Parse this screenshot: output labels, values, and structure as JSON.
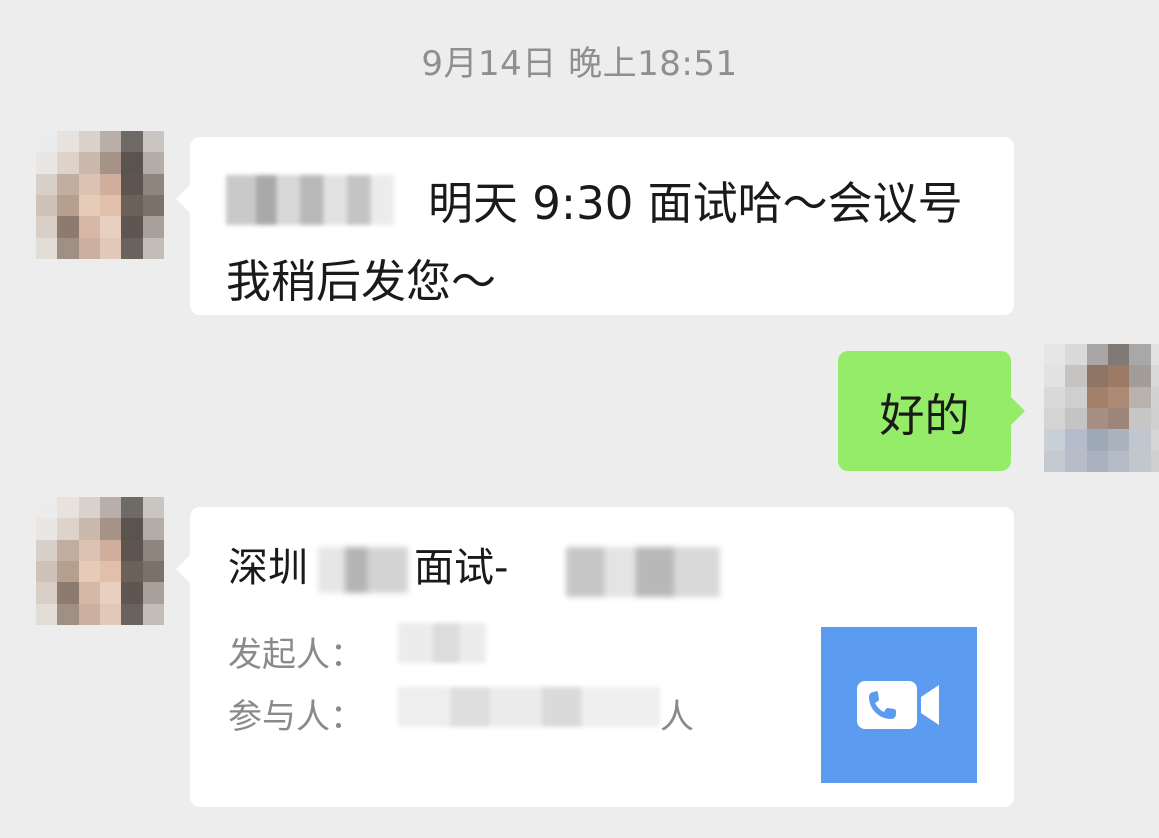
{
  "chat": {
    "timestamp": "9月14日 晚上18:51",
    "messages": [
      {
        "from": "contact",
        "text": "明天 9:30 面试哈～会议号我稍后发您～"
      },
      {
        "from": "me",
        "text": "好的"
      }
    ],
    "meeting_card": {
      "title_prefix": "深圳",
      "title_middle": "面试-",
      "initiator_label": "发起人：",
      "participants_label": "参与人：",
      "participants_suffix": "人",
      "icon": "video-call-icon",
      "icon_bg_color": "#5b9cf0"
    }
  },
  "colors": {
    "background": "#ededed",
    "incoming_bubble": "#ffffff",
    "outgoing_bubble": "#95ec69"
  }
}
